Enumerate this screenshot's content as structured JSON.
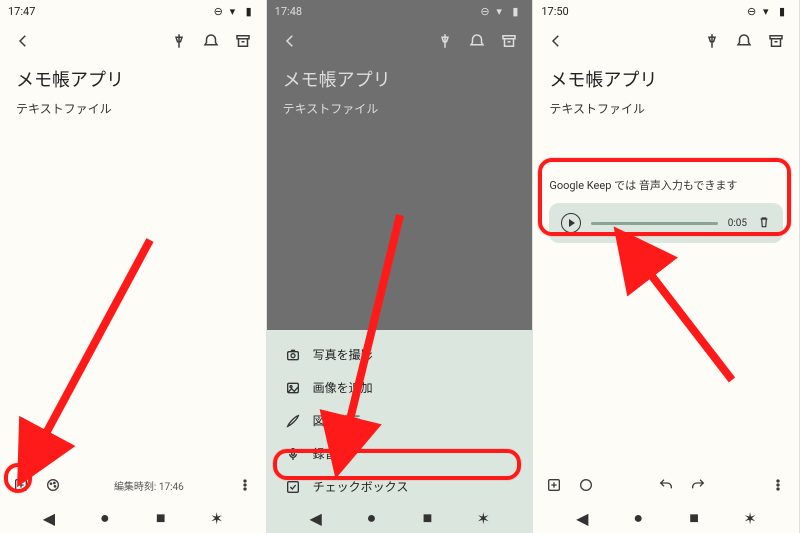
{
  "panels": [
    {
      "status_time": "17:47",
      "title": "メモ帳アプリ",
      "body": "テキストファイル",
      "edited": "編集時刻: 17:46"
    },
    {
      "status_time": "17:48",
      "title": "メモ帳アプリ",
      "body": "テキストファイル",
      "sheet": [
        {
          "icon": "camera",
          "label": "写真を撮影"
        },
        {
          "icon": "image",
          "label": "画像を追加"
        },
        {
          "icon": "brush",
          "label": "図形描画"
        },
        {
          "icon": "mic",
          "label": "録音"
        },
        {
          "icon": "checkbox",
          "label": "チェックボックス"
        }
      ]
    },
    {
      "status_time": "17:50",
      "title": "メモ帳アプリ",
      "body": "テキストファイル",
      "audio_label": "Google Keep では 音声入力もできます",
      "audio_duration": "0:05"
    }
  ],
  "colors": {
    "accent_red": "#ff1a1a",
    "sheet_bg": "#dbe6de"
  }
}
